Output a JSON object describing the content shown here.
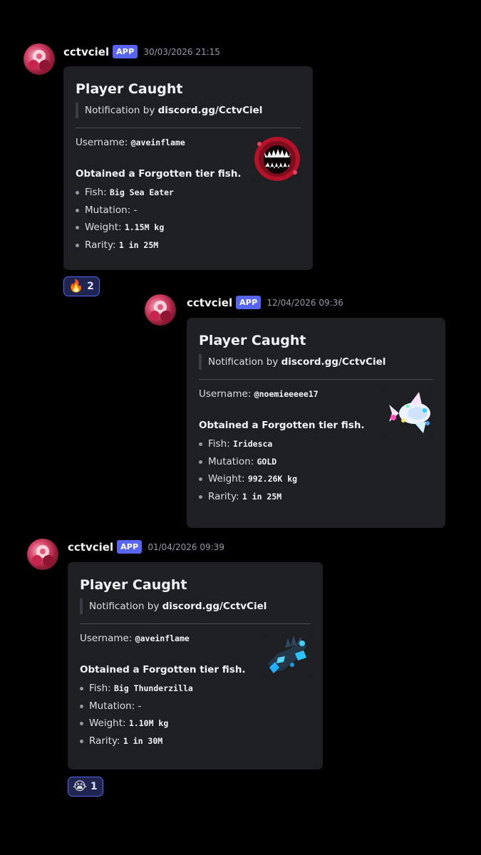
{
  "messages": [
    {
      "author": "cctvciel",
      "badge": "APP",
      "timestamp": "30/03/2026 21:15",
      "embed": {
        "title": "Player Caught",
        "notification_prefix": "Notification by ",
        "notification_link": "discord.gg/CctvCiel",
        "username_label": "Username: ",
        "username": "@aveinflame",
        "obtained": "Obtained a Forgotten tier fish.",
        "fish_label": "Fish: ",
        "fish": "Big Sea Eater",
        "mutation_label": "Mutation: ",
        "mutation": "-",
        "weight_label": "Weight: ",
        "weight": "1.15M kg",
        "rarity_label": "Rarity: ",
        "rarity": "1 in 25M",
        "thumbnail_icon": "sea-eater-thumbnail"
      },
      "reaction": {
        "emoji": "🔥",
        "icon": "fire-emoji",
        "count": "2"
      }
    },
    {
      "author": "cctvciel",
      "badge": "APP",
      "timestamp": "12/04/2026 09:36",
      "embed": {
        "title": "Player Caught",
        "notification_prefix": "Notification by ",
        "notification_link": "discord.gg/CctvCiel",
        "username_label": "Username: ",
        "username": "@noemieeeee17",
        "obtained": "Obtained a Forgotten tier fish.",
        "fish_label": "Fish: ",
        "fish": "Iridesca",
        "mutation_label": "Mutation: ",
        "mutation": "GOLD",
        "weight_label": "Weight: ",
        "weight": "992.26K kg",
        "rarity_label": "Rarity: ",
        "rarity": "1 in 25M",
        "thumbnail_icon": "iridesca-thumbnail"
      }
    },
    {
      "author": "cctvciel",
      "badge": "APP",
      "timestamp": "01/04/2026 09:39",
      "embed": {
        "title": "Player Caught",
        "notification_prefix": "Notification by ",
        "notification_link": "discord.gg/CctvCiel",
        "username_label": "Username: ",
        "username": "@aveinflame",
        "obtained": "Obtained a Forgotten tier fish.",
        "fish_label": "Fish: ",
        "fish": "Big Thunderzilla",
        "mutation_label": "Mutation: ",
        "mutation": "-",
        "weight_label": "Weight: ",
        "weight": "1.10M kg",
        "rarity_label": "Rarity: ",
        "rarity": "1 in 30M",
        "thumbnail_icon": "thunderzilla-thumbnail"
      },
      "reaction": {
        "emoji": "😭",
        "icon": "crying-face-emoji",
        "count": "1"
      }
    }
  ],
  "colors": {
    "background": "#000000",
    "embed_bg": "#1e1f22",
    "badge": "#5865f2",
    "reaction_border": "#5865f2"
  }
}
